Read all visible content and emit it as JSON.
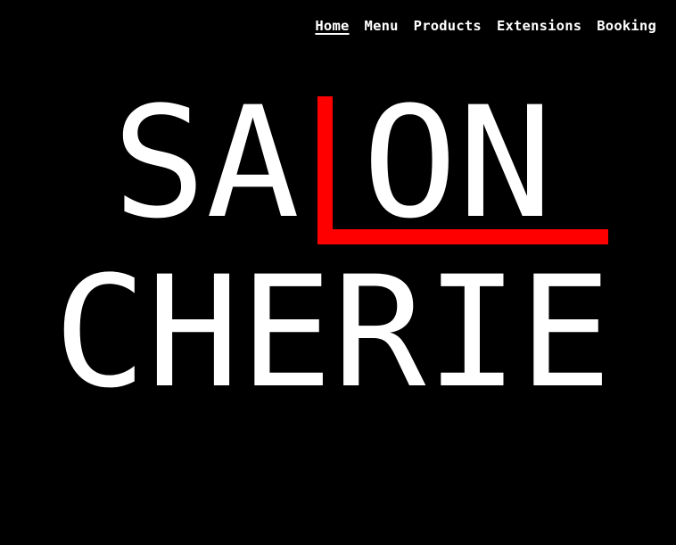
{
  "nav": {
    "items": [
      {
        "label": "Home",
        "active": true
      },
      {
        "label": "Menu",
        "active": false
      },
      {
        "label": "Products",
        "active": false
      },
      {
        "label": "Extensions",
        "active": false
      },
      {
        "label": "Booking",
        "active": false
      }
    ]
  },
  "logo": {
    "line1_left": "SA",
    "line1_right": "ON",
    "line2": "CHERIE",
    "colors": {
      "text": "#ffffff",
      "accent": "#ff0000",
      "background": "#000000"
    }
  }
}
